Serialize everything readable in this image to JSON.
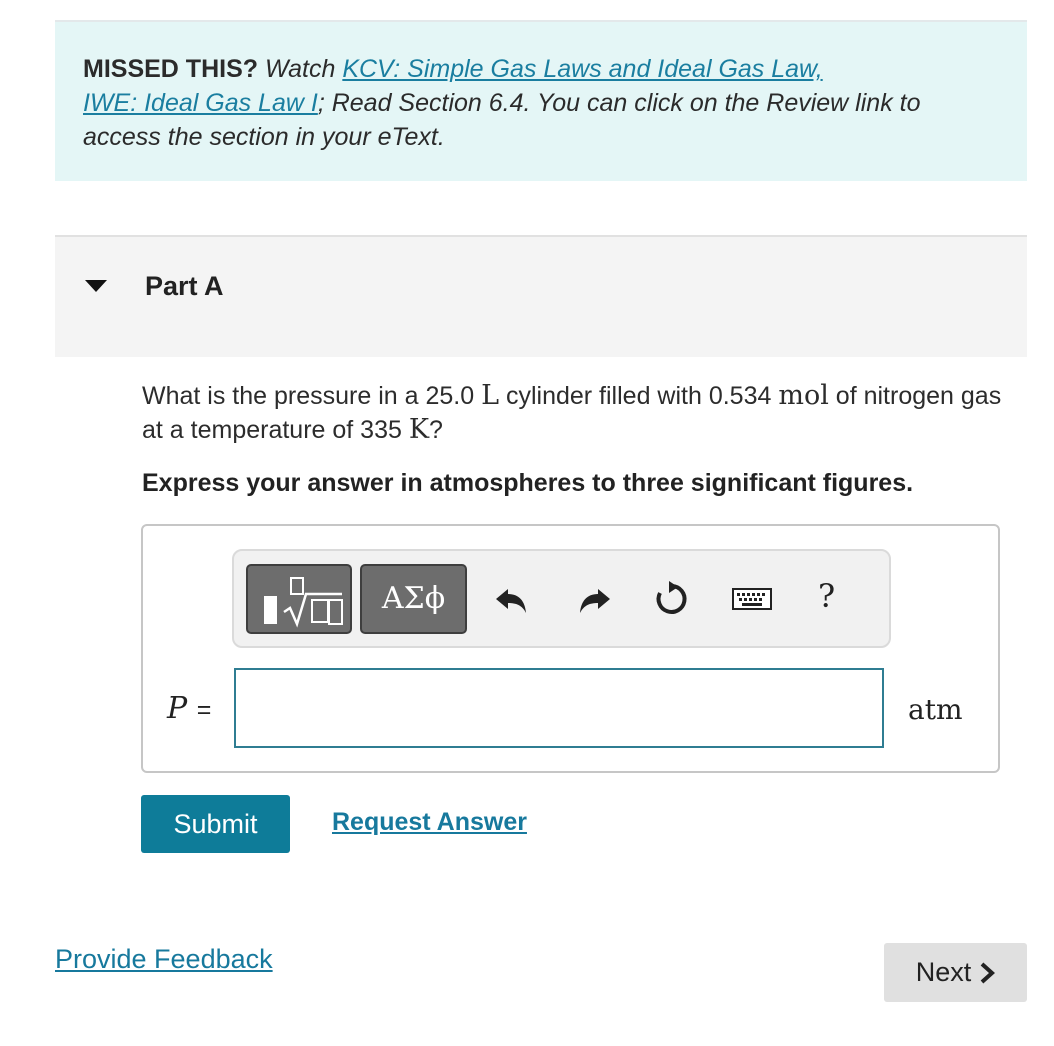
{
  "missed": {
    "lead": "MISSED THIS?",
    "watch": "Watch",
    "link_kcv": "KCV: Simple Gas Laws and Ideal Gas Law,",
    "link_iwe": "IWE: Ideal Gas Law I",
    "rest": "; Read Section 6.4. You can click on the Review link to access the section in your eText."
  },
  "part": {
    "title": "Part A"
  },
  "question": {
    "t1": "What is the pressure in a 25.0",
    "u1": "L",
    "t2": "cylinder filled with 0.534",
    "u2": "mol",
    "t3": "of nitrogen gas at a temperature of 335",
    "u3": "K",
    "t4": "?"
  },
  "instruction": "Express your answer in atmospheres to three significant figures.",
  "toolbar": {
    "greek_label": "ΑΣϕ",
    "help_label": "?"
  },
  "answer": {
    "variable": "P",
    "equals": "=",
    "value": "",
    "unit": "atm"
  },
  "actions": {
    "submit": "Submit",
    "request_answer": "Request Answer",
    "feedback": "Provide Feedback",
    "next": "Next"
  },
  "colors": {
    "accent": "#0e7c99",
    "link": "#17799d",
    "banner_bg": "#e4f6f6"
  }
}
